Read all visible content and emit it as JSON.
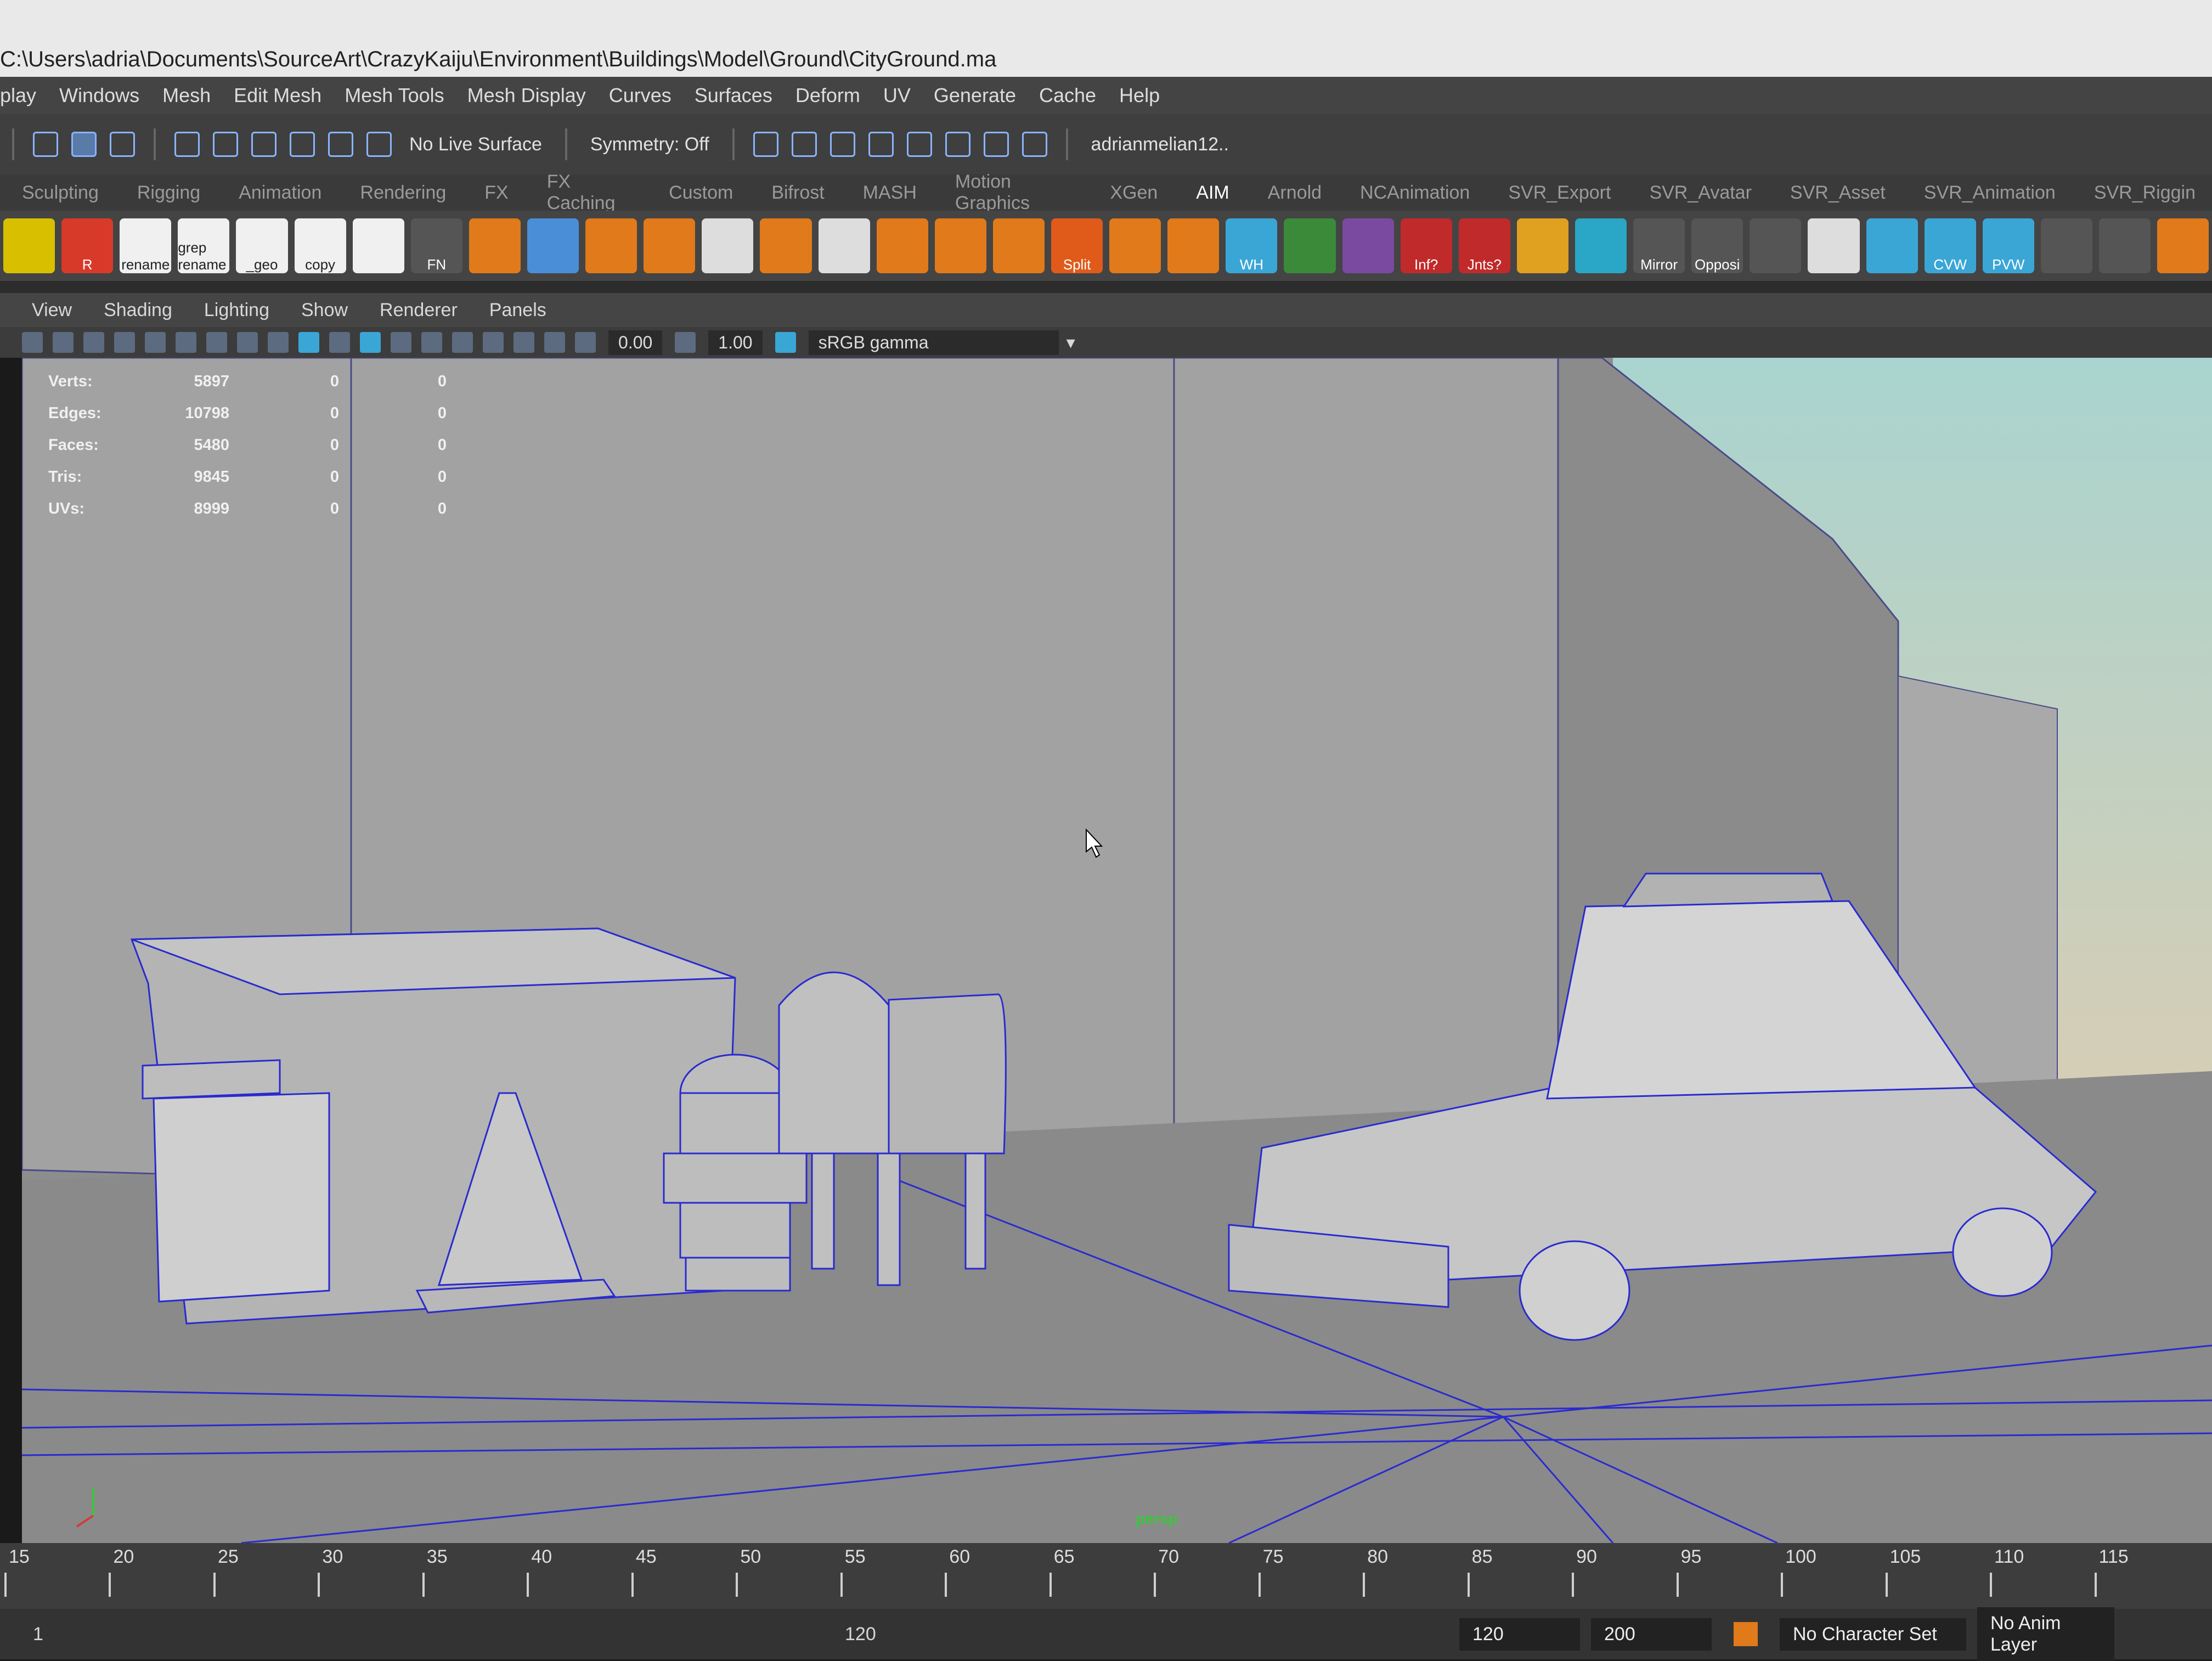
{
  "window": {
    "path": "C:\\Users\\adria\\Documents\\SourceArt\\CrazyKaiju\\Environment\\Buildings\\Model\\Ground\\CityGround.ma"
  },
  "menubar": [
    "play",
    "Windows",
    "Mesh",
    "Edit Mesh",
    "Mesh Tools",
    "Mesh Display",
    "Curves",
    "Surfaces",
    "Deform",
    "UV",
    "Generate",
    "Cache",
    "Help"
  ],
  "statusline": {
    "live_surface": "No Live Surface",
    "symmetry": "Symmetry: Off",
    "user": "adrianmelian12.."
  },
  "shelf_tabs": [
    "Sculpting",
    "Rigging",
    "Animation",
    "Rendering",
    "FX",
    "FX Caching",
    "Custom",
    "Bifrost",
    "MASH",
    "Motion Graphics",
    "XGen",
    "AIM",
    "Arnold",
    "NCAnimation",
    "SVR_Export",
    "SVR_Avatar",
    "SVR_Asset",
    "SVR_Animation",
    "SVR_Riggin"
  ],
  "shelf_active_tab": "AIM",
  "shelf_buttons": [
    {
      "label": "",
      "icon": "pencil-icon",
      "color": "#d8c000"
    },
    {
      "label": "R",
      "icon": "rename-r-icon",
      "color": "#d83a2a"
    },
    {
      "label": "rename",
      "icon": "hash-rename-icon",
      "color": "#f0f0f0"
    },
    {
      "label": "grep rename",
      "icon": "grep-rename-icon",
      "color": "#f0f0f0"
    },
    {
      "label": "_geo",
      "icon": "geo-suffix-icon",
      "color": "#f0f0f0"
    },
    {
      "label": "copy",
      "icon": "crosshair-copy-icon",
      "color": "#f0f0f0"
    },
    {
      "label": "",
      "icon": "red-plus-icon",
      "color": "#f0f0f0"
    },
    {
      "label": "FN",
      "icon": "eye-fn-icon",
      "color": "#555555"
    },
    {
      "label": "",
      "icon": "grid-orange-icon",
      "color": "#e07a1a"
    },
    {
      "label": "",
      "icon": "brush-icon",
      "color": "#4a8ed8"
    },
    {
      "label": "",
      "icon": "extrude-icon",
      "color": "#e07a1a"
    },
    {
      "label": "",
      "icon": "bevel-icon",
      "color": "#e07a1a"
    },
    {
      "label": "",
      "icon": "multicut-icon",
      "color": "#dddddd"
    },
    {
      "label": "",
      "icon": "cube-orange-icon",
      "color": "#e07a1a"
    },
    {
      "label": "",
      "icon": "delete-vert-icon",
      "color": "#dddddd"
    },
    {
      "label": "",
      "icon": "bridge-icon",
      "color": "#e07a1a"
    },
    {
      "label": "",
      "icon": "combine-icon",
      "color": "#e07a1a"
    },
    {
      "label": "",
      "icon": "separate-icon",
      "color": "#e07a1a"
    },
    {
      "label": "Split",
      "icon": "split-icon",
      "color": "#e05a1a"
    },
    {
      "label": "",
      "icon": "mirror-blocks-icon",
      "color": "#e07a1a"
    },
    {
      "label": "",
      "icon": "sphere-wire-icon",
      "color": "#e07a1a"
    },
    {
      "label": "WH",
      "icon": "wh-icon",
      "color": "#3aa6d6"
    },
    {
      "label": "",
      "icon": "checker-icon",
      "color": "#3a8a3a"
    },
    {
      "label": "",
      "icon": "purple-frame-icon",
      "color": "#7a4aa0"
    },
    {
      "label": "Inf?",
      "icon": "question-icon",
      "color": "#c02a2a"
    },
    {
      "label": "Jnts?",
      "icon": "question-jnts-icon",
      "color": "#c02a2a"
    },
    {
      "label": "",
      "icon": "character-icon",
      "color": "#e0a020"
    },
    {
      "label": "",
      "icon": "ring-icon",
      "color": "#2aa6c6"
    },
    {
      "label": "Mirror",
      "icon": "mirror-icon",
      "color": "#555555"
    },
    {
      "label": "Opposi",
      "icon": "opposite-icon",
      "color": "#555555"
    },
    {
      "label": "",
      "icon": "refresh-icon",
      "color": "#555555"
    },
    {
      "label": "",
      "icon": "grid-joint-icon",
      "color": "#dddddd"
    },
    {
      "label": "",
      "icon": "bone-icon",
      "color": "#3aa6d6"
    },
    {
      "label": "CVW",
      "icon": "cvw-icon",
      "color": "#3aa6d6"
    },
    {
      "label": "PVW",
      "icon": "pvw-icon",
      "color": "#3aa6d6"
    },
    {
      "label": "",
      "icon": "remove-icon",
      "color": "#555555"
    },
    {
      "label": "",
      "icon": "cycle-icon",
      "color": "#555555"
    },
    {
      "label": "",
      "icon": "orange-sphere-icon",
      "color": "#e07a1a"
    }
  ],
  "panel_menu": [
    "View",
    "Shading",
    "Lighting",
    "Show",
    "Renderer",
    "Panels"
  ],
  "panel_toolbar": {
    "exposure": "0.00",
    "gamma": "1.00",
    "color_space": "sRGB gamma"
  },
  "hud": {
    "rows": [
      {
        "label": "Verts:",
        "value": "5897",
        "sel": "0",
        "comp": "0"
      },
      {
        "label": "Edges:",
        "value": "10798",
        "sel": "0",
        "comp": "0"
      },
      {
        "label": "Faces:",
        "value": "5480",
        "sel": "0",
        "comp": "0"
      },
      {
        "label": "Tris:",
        "value": "9845",
        "sel": "0",
        "comp": "0"
      },
      {
        "label": "UVs:",
        "value": "8999",
        "sel": "0",
        "comp": "0"
      }
    ]
  },
  "camera": "persp",
  "timeline": {
    "ticks": [
      "15",
      "20",
      "25",
      "30",
      "35",
      "40",
      "45",
      "50",
      "55",
      "60",
      "65",
      "70",
      "75",
      "80",
      "85",
      "90",
      "95",
      "100",
      "105",
      "110",
      "115"
    ]
  },
  "range": {
    "start": "1",
    "inner_end": "120",
    "end": "120",
    "anim_end": "200",
    "character_set": "No Character Set",
    "anim_layer": "No Anim Layer"
  }
}
